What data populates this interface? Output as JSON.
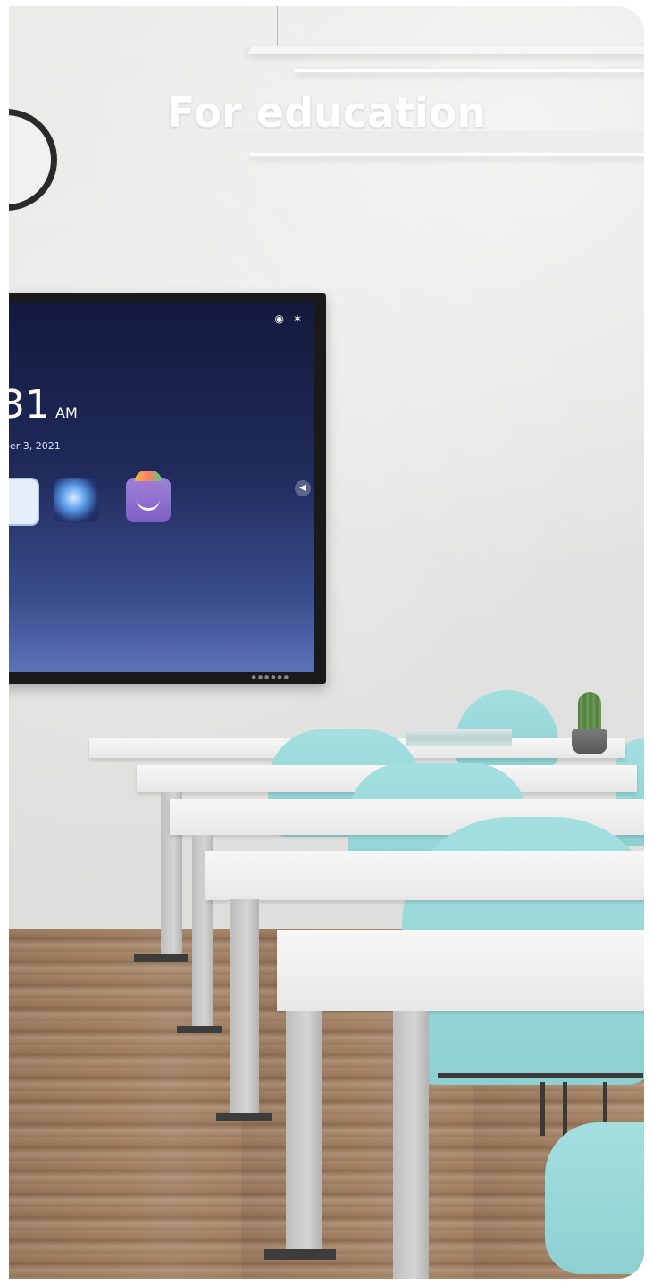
{
  "hero": {
    "title": "For education"
  },
  "display": {
    "time": "31",
    "ampm": "AM",
    "date": "ber 3, 2021",
    "status_icons": [
      "wifi-icon",
      "bluetooth-icon"
    ],
    "apps": [
      "cast-app-icon",
      "browser-app-icon",
      "app-store-icon"
    ]
  },
  "colors": {
    "wall": "#e4e4e3",
    "screen_top": "#141a3d",
    "screen_bottom": "#5a73b8",
    "chair": "#9ed8da",
    "floor": "#9b7a5d"
  }
}
